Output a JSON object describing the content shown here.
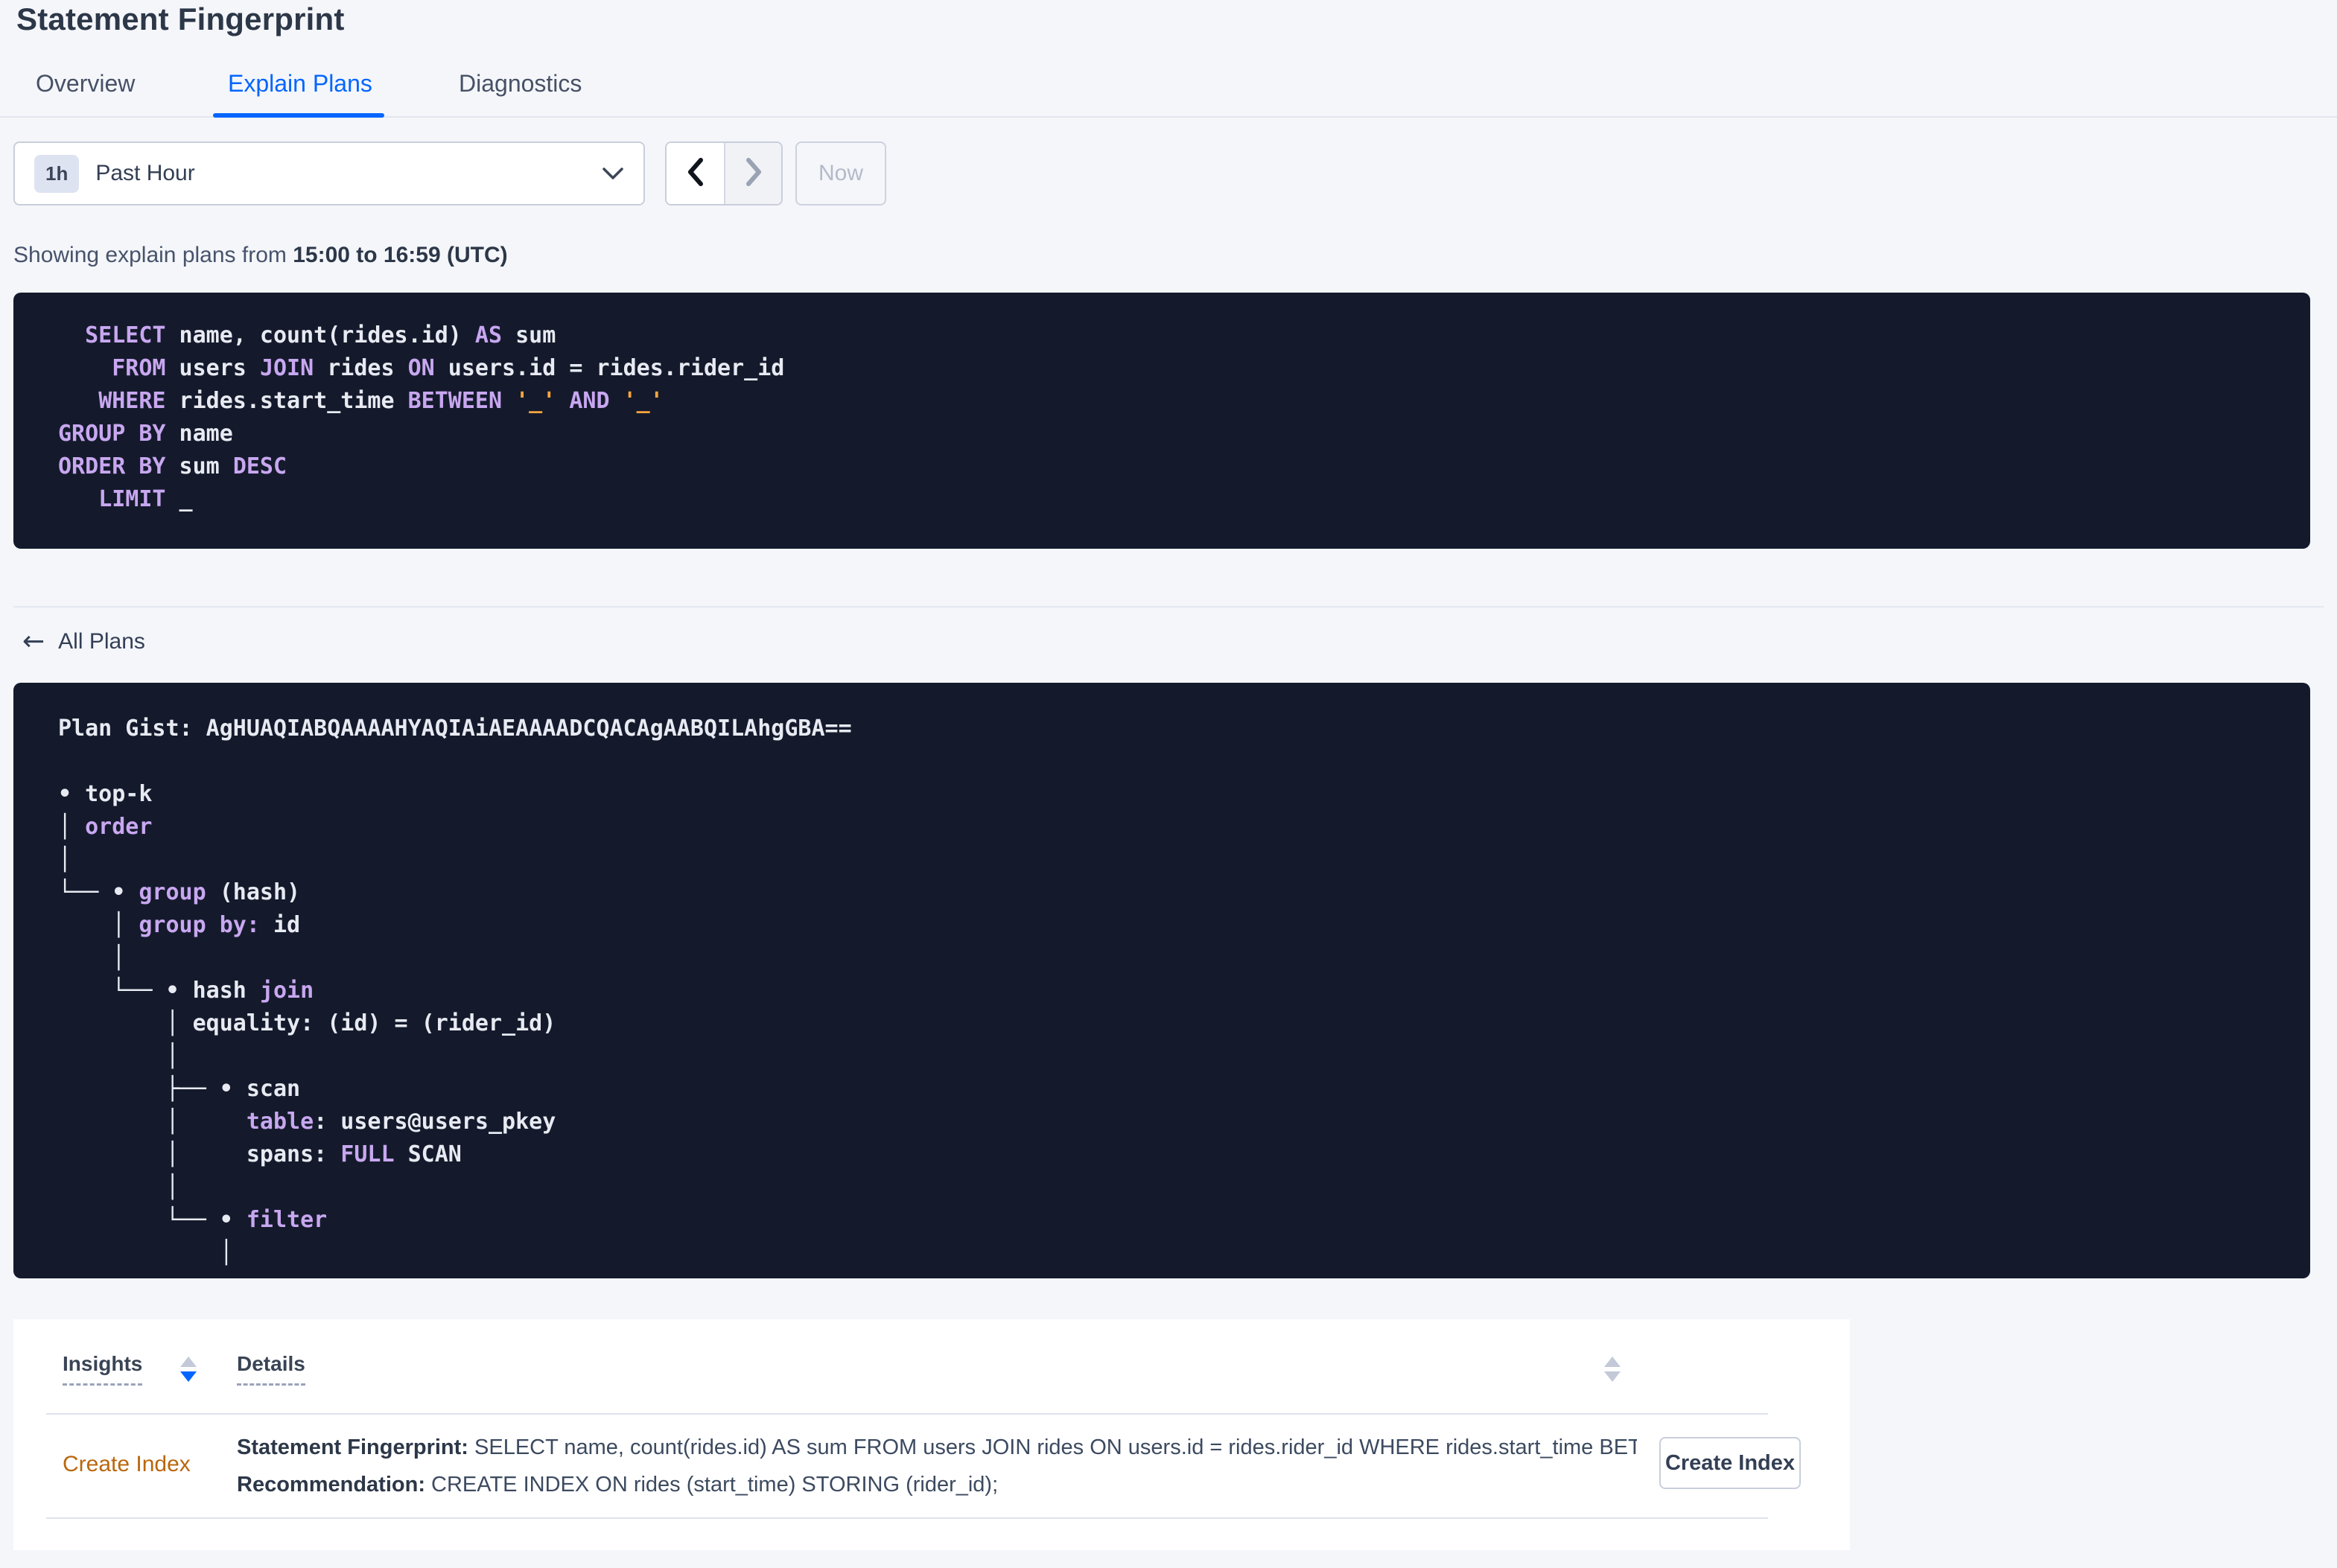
{
  "page": {
    "title": "Statement Fingerprint"
  },
  "tabs": [
    {
      "label": "Overview",
      "active": false
    },
    {
      "label": "Explain Plans",
      "active": true
    },
    {
      "label": "Diagnostics",
      "active": false
    }
  ],
  "time_picker": {
    "badge": "1h",
    "selected": "Past Hour",
    "now_label": "Now",
    "prev_enabled": true,
    "next_enabled": false
  },
  "range_line": {
    "prefix": "Showing explain plans from ",
    "range": "15:00 to 16:59 (UTC)"
  },
  "sql": {
    "lines": [
      [
        {
          "t": "  ",
          "c": "i"
        },
        {
          "t": "SELECT",
          "c": "k"
        },
        {
          "t": " name, count(rides.id) ",
          "c": "i"
        },
        {
          "t": "AS",
          "c": "k"
        },
        {
          "t": " sum",
          "c": "i"
        }
      ],
      [
        {
          "t": "    ",
          "c": "i"
        },
        {
          "t": "FROM",
          "c": "k"
        },
        {
          "t": " users ",
          "c": "i"
        },
        {
          "t": "JOIN",
          "c": "k"
        },
        {
          "t": " rides ",
          "c": "i"
        },
        {
          "t": "ON",
          "c": "k"
        },
        {
          "t": " users.id = rides.rider_id",
          "c": "i"
        }
      ],
      [
        {
          "t": "   ",
          "c": "i"
        },
        {
          "t": "WHERE",
          "c": "k"
        },
        {
          "t": " rides.start_time ",
          "c": "i"
        },
        {
          "t": "BETWEEN",
          "c": "k"
        },
        {
          "t": " ",
          "c": "i"
        },
        {
          "t": "'_'",
          "c": "l"
        },
        {
          "t": " ",
          "c": "i"
        },
        {
          "t": "AND",
          "c": "k"
        },
        {
          "t": " ",
          "c": "i"
        },
        {
          "t": "'_'",
          "c": "l"
        }
      ],
      [
        {
          "t": "GROUP BY",
          "c": "k"
        },
        {
          "t": " name",
          "c": "i"
        }
      ],
      [
        {
          "t": "ORDER BY",
          "c": "k"
        },
        {
          "t": " sum ",
          "c": "i"
        },
        {
          "t": "DESC",
          "c": "k"
        }
      ],
      [
        {
          "t": "   ",
          "c": "i"
        },
        {
          "t": "LIMIT",
          "c": "k"
        },
        {
          "t": " _",
          "c": "i"
        }
      ]
    ]
  },
  "back_link": {
    "label": "All Plans",
    "icon": "arrow-left"
  },
  "plan": {
    "gist": "Plan Gist: AgHUAQIABQAAAAHYAQIAiAEAAAADCQACAgAABQILAhgGBA==",
    "tree": [
      [
        {
          "t": "• top-k",
          "c": "i"
        }
      ],
      [
        {
          "t": "│ ",
          "c": "i"
        },
        {
          "t": "order",
          "c": "k"
        }
      ],
      [
        {
          "t": "│",
          "c": "i"
        }
      ],
      [
        {
          "t": "└── • ",
          "c": "i"
        },
        {
          "t": "group",
          "c": "k"
        },
        {
          "t": " (hash)",
          "c": "i"
        }
      ],
      [
        {
          "t": "    │ ",
          "c": "i"
        },
        {
          "t": "group by:",
          "c": "k"
        },
        {
          "t": " id",
          "c": "i"
        }
      ],
      [
        {
          "t": "    │",
          "c": "i"
        }
      ],
      [
        {
          "t": "    └── • hash ",
          "c": "i"
        },
        {
          "t": "join",
          "c": "k"
        }
      ],
      [
        {
          "t": "        │ equality: (id) = (rider_id)",
          "c": "i"
        }
      ],
      [
        {
          "t": "        │",
          "c": "i"
        }
      ],
      [
        {
          "t": "        ├── • scan",
          "c": "i"
        }
      ],
      [
        {
          "t": "        │     ",
          "c": "i"
        },
        {
          "t": "table",
          "c": "k"
        },
        {
          "t": ": users@users_pkey",
          "c": "i"
        }
      ],
      [
        {
          "t": "        │     spans: ",
          "c": "i"
        },
        {
          "t": "FULL",
          "c": "k"
        },
        {
          "t": " SCAN",
          "c": "i"
        }
      ],
      [
        {
          "t": "        │",
          "c": "i"
        }
      ],
      [
        {
          "t": "        └── • ",
          "c": "i"
        },
        {
          "t": "filter",
          "c": "k"
        }
      ],
      [
        {
          "t": "            │",
          "c": "i"
        }
      ]
    ]
  },
  "insights_table": {
    "columns": [
      {
        "label": "Insights",
        "sort": "desc"
      },
      {
        "label": "Details",
        "sort": "none"
      }
    ],
    "rows": [
      {
        "insight": "Create Index",
        "details": [
          {
            "label": "Statement Fingerprint:",
            "text": " SELECT name, count(rides.id) AS sum FROM users JOIN rides ON users.id = rides.rider_id WHERE rides.start_time BETWEEN '_…"
          },
          {
            "label": "Recommendation:",
            "text": " CREATE INDEX ON rides (start_time) STORING (rider_id);"
          }
        ],
        "action_label": "Create Index"
      }
    ]
  },
  "colors": {
    "accent_blue": "#0565ff",
    "keyword_purple": "#c8a7f0",
    "literal_orange": "#ffa53e",
    "link_orange": "#b9670e",
    "code_background": "#141a2c",
    "title_text": "#2c3748",
    "body_text": "#394455",
    "disabled_text": "#b3bac9"
  }
}
